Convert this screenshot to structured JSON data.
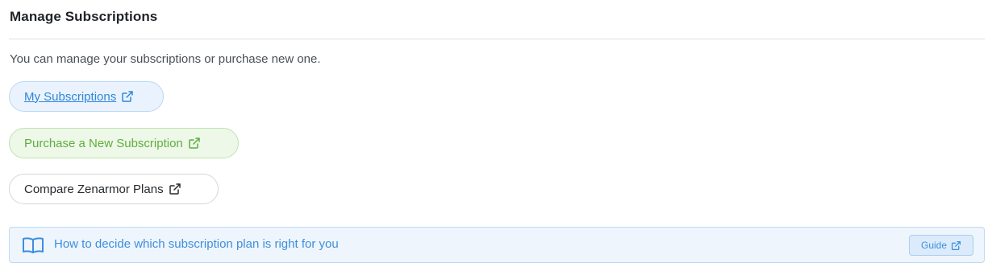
{
  "section": {
    "title": "Manage Subscriptions",
    "description": "You can manage your subscriptions or purchase new one."
  },
  "buttons": {
    "my_subscriptions": "My Subscriptions",
    "purchase_new": "Purchase a New Subscription",
    "compare_plans": "Compare Zenarmor Plans"
  },
  "banner": {
    "text": "How to decide which subscription plan is right for you",
    "guide_label": "Guide"
  },
  "colors": {
    "blue": "#2f86d8",
    "green": "#5fae3c",
    "text": "#262a2e"
  },
  "icons": {
    "external_link": "external-link-icon",
    "book": "book-open-icon"
  }
}
